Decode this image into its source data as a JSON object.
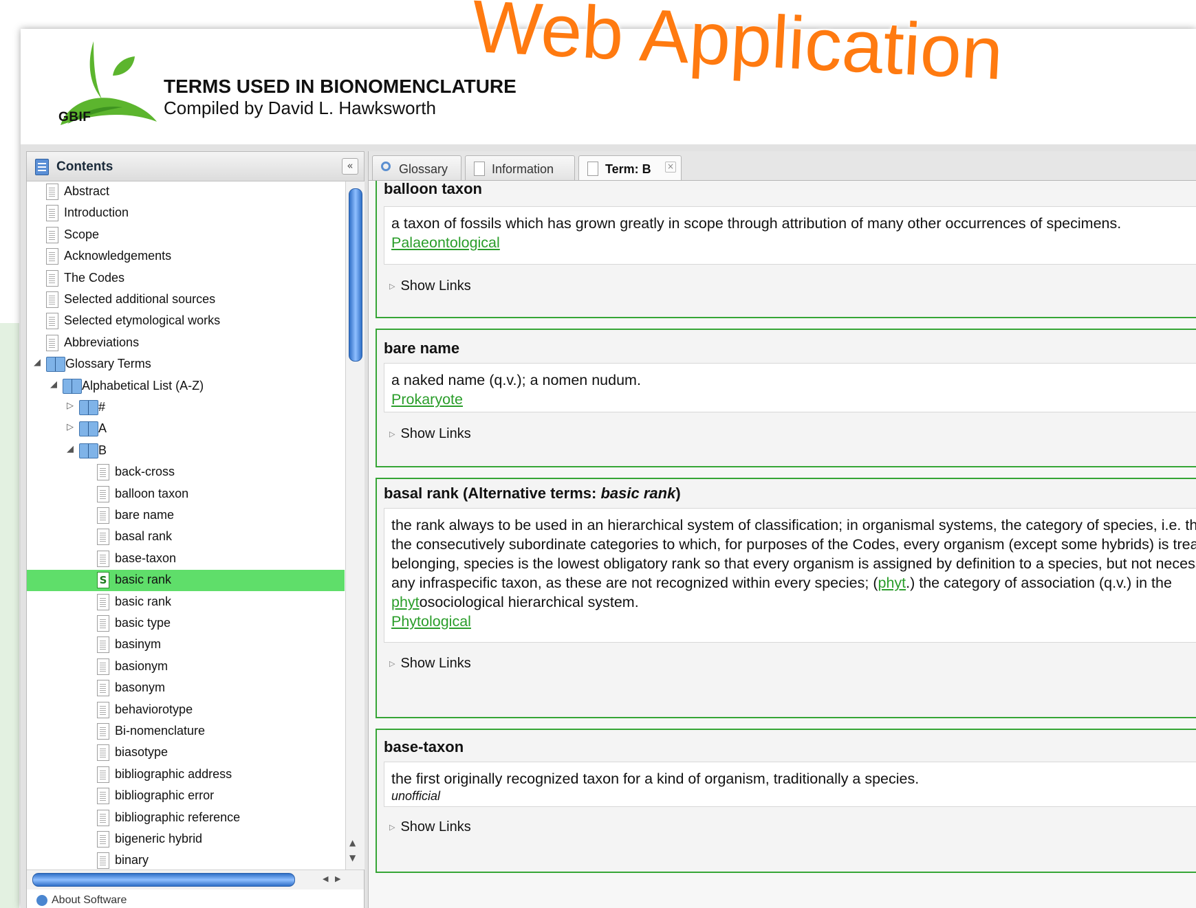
{
  "overlay": {
    "title": "Web Application"
  },
  "header": {
    "logo_text": "GBIF",
    "title": "TERMS USED IN BIONOMENCLATURE",
    "subtitle": "Compiled by David L. Hawksworth"
  },
  "contents": {
    "title": "Contents",
    "collapse_label": "«",
    "about_label": "About Software",
    "top_items": [
      "Abstract",
      "Introduction",
      "Scope",
      "Acknowledgements",
      "The Codes",
      "Selected additional sources",
      "Selected etymological works",
      "Abbreviations"
    ],
    "glossary_terms": "Glossary Terms",
    "alphabetical_list": "Alphabetical List (A-Z)",
    "letters": [
      "#",
      "A",
      "B"
    ],
    "b_items": [
      "back-cross",
      "balloon taxon",
      "bare name",
      "basal rank",
      "base-taxon",
      "basic rank",
      "basic rank",
      "basic type",
      "basinym",
      "basionym",
      "basonym",
      "behaviorotype",
      "Bi-nomenclature",
      "biasotype",
      "bibliographic address",
      "bibliographic error",
      "bibliographic reference",
      "bigeneric hybrid",
      "binary"
    ],
    "selected_item": "basic rank",
    "species_icon_letter": "S"
  },
  "tabs": [
    {
      "label": "Glossary",
      "icon": "search-icon",
      "active": false
    },
    {
      "label": "Information",
      "icon": "document-icon",
      "active": false
    },
    {
      "label": "Term: B",
      "icon": "document-icon",
      "active": true,
      "close": "×"
    }
  ],
  "terms": {
    "balloon_taxon": {
      "name": "balloon taxon",
      "definition": "a taxon of fossils which has grown greatly in scope through attribution of many other occurrences of specimens.",
      "category": "Palaeontological",
      "show_links": "Show Links"
    },
    "bare_name": {
      "name": "bare name",
      "definition": "a naked name (q.v.); a nomen nudum.",
      "category": "Prokaryote",
      "show_links": "Show Links"
    },
    "basal_rank": {
      "name": "basal rank (Alternative terms: ",
      "alt": "basic rank",
      "close": ")",
      "def_part1": "the rank always to be used in an hierarchical system of classification; in organismal systems, the category of species, i.e. that of all the consecutively subordinate categories to which, for purposes of the Codes, every organism (except some hybrids) is treated as belonging, species is the lowest obligatory rank so that every organism is assigned by definition to a species, but not necessarily to any infraspecific taxon, as these are not recognized within every species; (",
      "link1": "phyt",
      "def_part2": ".) the category of association (q.v.) in the ",
      "link2": "phyt",
      "def_part3": "osociological hierarchical system.",
      "category": "Phytological",
      "show_links": "Show Links"
    },
    "base_taxon": {
      "name": "base-taxon",
      "definition": "the first originally recognized taxon for a kind of organism, traditionally a species.",
      "category": "unofficial",
      "show_links": "Show Links"
    }
  },
  "colors": {
    "accent_green": "#35a535",
    "selection": "#5fde6a",
    "overlay": "#ff7a10",
    "link": "#2a9d2a"
  }
}
